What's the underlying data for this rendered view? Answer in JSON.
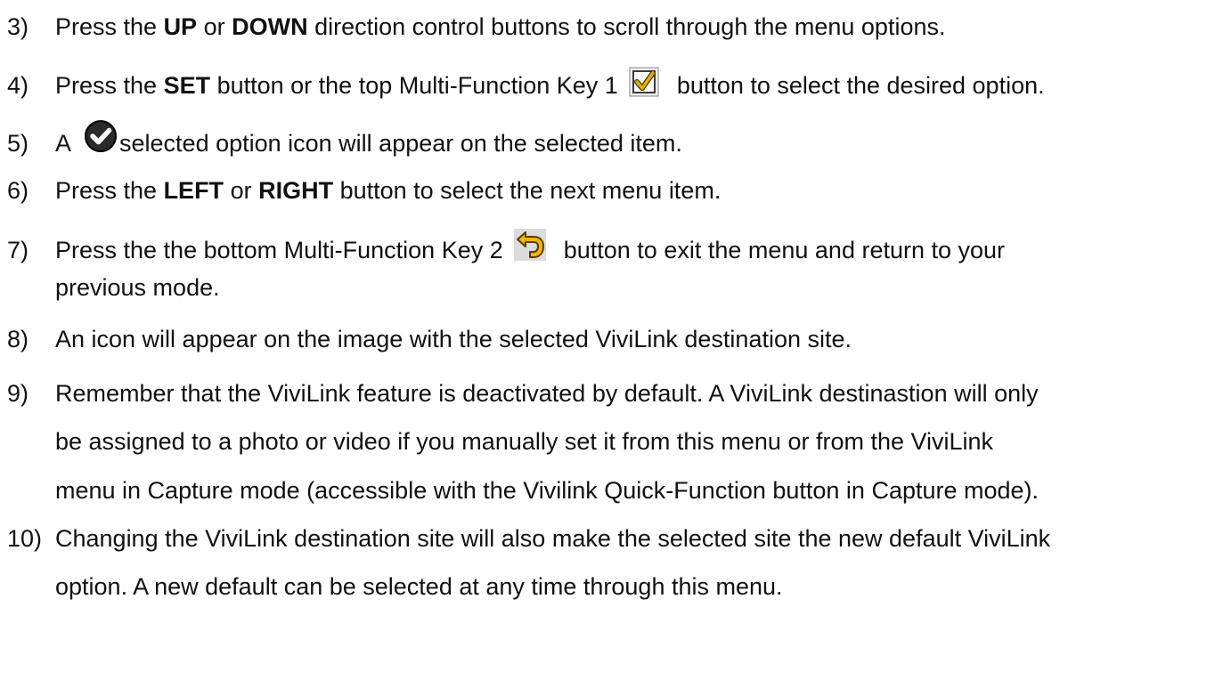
{
  "steps": [
    {
      "num": "3)",
      "parts": [
        "Press the ",
        "UP",
        " or ",
        "DOWN",
        " direction control buttons to scroll through the menu options."
      ]
    },
    {
      "num": "4)",
      "parts": [
        "Press the ",
        "SET",
        " button or the top Multi-Function Key 1",
        "button to select the desired option."
      ]
    },
    {
      "num": "5)",
      "parts": [
        "A",
        "selected option icon will appear on the selected item."
      ]
    },
    {
      "num": "6)",
      "parts": [
        "Press the ",
        "LEFT",
        " or ",
        "RIGHT",
        " button to select the next menu item."
      ]
    },
    {
      "num": "7)",
      "parts": [
        "Press the the bottom Multi-Function Key 2",
        "button to exit the menu and return to your",
        "previous mode."
      ]
    },
    {
      "num": "8)",
      "text": "An icon will appear on the image with the selected ViviLink destination site."
    },
    {
      "num": "9)",
      "lines": [
        "Remember that the ViviLink feature is deactivated by default. A ViviLink destinastion will only",
        "be assigned to a photo or video if you manually set it from this menu or from the ViviLink",
        "menu in Capture mode (accessible with the Vivilink Quick-Function button in Capture mode)."
      ]
    },
    {
      "num": "10)",
      "lines": [
        "Changing the ViviLink destination site will also make the selected site the new default ViviLink",
        "option. A new default can be selected at any time through this menu."
      ]
    }
  ],
  "icons": {
    "set": "checkbox-check-icon",
    "selected": "check-circle-icon",
    "back": "return-arrow-icon"
  },
  "colors": {
    "text": "#111111",
    "set_icon_check": "#e0b000",
    "back_icon_arrow": "#f0b800",
    "selected_icon": "#1a1a1a"
  }
}
